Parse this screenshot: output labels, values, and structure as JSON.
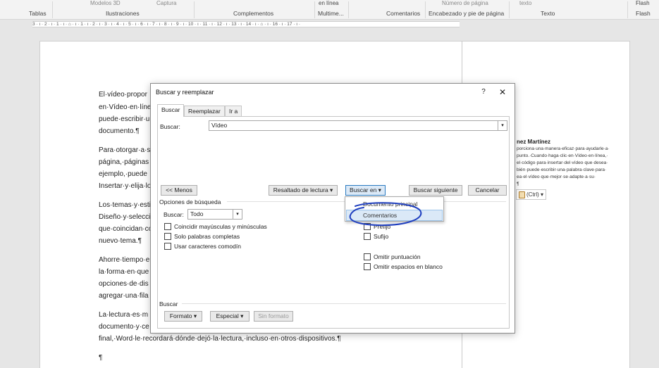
{
  "ribbon": {
    "groups": [
      "Tablas",
      "Ilustraciones",
      "Complementos",
      "Multime...",
      "Comentarios",
      "Encabezado y pie de página",
      "Texto",
      "Flash"
    ],
    "top_items": {
      "models": "Modelos 3D",
      "capture": "Captura",
      "online": "en línea",
      "page_number": "Número de página",
      "text": "texto",
      "flash": "Flash"
    }
  },
  "ruler": {
    "scale": "3 · ı · 2 · ı · 1 · ı · ⌂ · ı · 1 · ı · 2 · ı · 3 · ı · 4 · ı · 5 · ı · 6 · ı · 7 · ı · 8 · ı · 9 · ı · 10 · ı · 11 · ı · 12 · ı · 13 · ı · 14 · ı · ⌂ · ı · 16 · ı · 17 · ı ·"
  },
  "document": {
    "lines": [
      "El·vídeo·propor",
      "en·Vídeo·en·líne",
      "puede·escribir·u",
      "documento.¶",
      "Para·otorgar·a·s",
      "página,·páginas",
      "ejemplo,·puede",
      "Insertar·y·elija·lo",
      "Los·temas·y·estil",
      "Diseño·y·selecci",
      "que·coincidan·co",
      "nuevo·tema.¶",
      "Ahorre·tiempo·e",
      "la·forma·en·que",
      "opciones·de·dis",
      "agregar·una·fila",
      "La·lectura·es·m",
      "documento·y·ce",
      "final,·Word·le·recordará·dónde·dejó·la·lectura,·incluso·en·otros·dispositivos.¶",
      "¶"
    ]
  },
  "comment": {
    "author": "nez Martínez",
    "lines": [
      "porciona·una·manera·eficaz·para·ayudarle·a·",
      "punto.·Cuando·haga·clic·en·Vídeo·en·línea,·",
      "el·código·para·insertar·del·vídeo·que·desea·",
      "bién·puede·escribir·una·palabra·clave·para·",
      "ea·el·vídeo·que·mejor·se·adapte·a·su·",
      "¶"
    ],
    "paste_ctrl": "(Ctrl) ▾"
  },
  "dialog": {
    "title": "Buscar y reemplazar",
    "help": "?",
    "close": "✕",
    "tabs": [
      "Buscar",
      "Reemplazar",
      "Ir a"
    ],
    "find_label": "Buscar:",
    "find_value": "Vídeo",
    "buttons": {
      "less": "<< Menos",
      "reading_highlight": "Resaltado de lectura ▾",
      "find_in": "Buscar en ▾",
      "find_next": "Buscar siguiente",
      "cancel": "Cancelar"
    },
    "options_heading": "Opciones de búsqueda",
    "search_label": "Buscar:",
    "search_value": "Todo",
    "left_options": [
      "Coincidir mayúsculas y minúsculas",
      "Solo palabras completas",
      "Usar caracteres comodín"
    ],
    "right_options": [
      "Prefijo",
      "Sufijo",
      "Omitir puntuación",
      "Omitir espacios en blanco"
    ],
    "bottom_section": "Buscar",
    "bottom_buttons": {
      "format": "Formato ▾",
      "special": "Especial ▾",
      "no_format": "Sin formato"
    }
  },
  "dropdown": {
    "items": [
      "Documento principal",
      "Comentarios"
    ],
    "highlighted": "Comentarios"
  },
  "colors": {
    "accent": "#2a7ac0",
    "annotation": "#1f3fbf"
  }
}
